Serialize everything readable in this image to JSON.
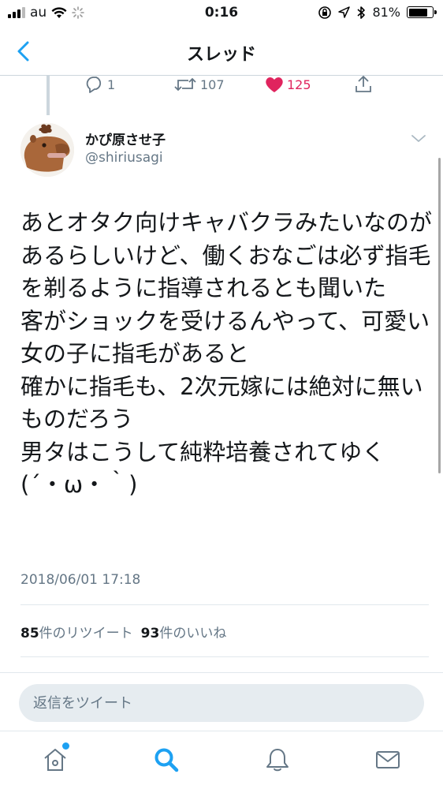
{
  "status_bar": {
    "carrier": "au",
    "time": "0:16",
    "battery": "81%"
  },
  "nav": {
    "title": "スレッド",
    "icons": [
      "back-chevron-icon"
    ]
  },
  "prev_tweet_actions": {
    "replies": "1",
    "retweets": "107",
    "likes": "125"
  },
  "tweet": {
    "author_name": "かぴ原させ子",
    "author_handle": "@shiriusagi",
    "text": "あとオタク向けキャバクラみたいなのがあるらしいけど、働くおなごは必ず指毛を剃るように指導されるとも聞いた\n客がショックを受けるんやって、可愛い女の子に指毛があると\n確かに指毛も、2次元嫁には絶対に無いものだろう\n男タはこうして純粋培養されてゆく\n(´・ω・｀)",
    "timestamp": "2018/06/01 17:18",
    "retweet_count": "85",
    "retweet_label": "件のリツイート",
    "like_count": "93",
    "like_label": "件のいいね"
  },
  "reply": {
    "placeholder": "返信をツイート"
  },
  "tabbar": {
    "icons": [
      "home-icon",
      "search-icon",
      "notifications-icon",
      "messages-icon"
    ],
    "active": "search"
  },
  "colors": {
    "accent": "#1da1f2",
    "like": "#e0245e",
    "muted": "#657786"
  }
}
